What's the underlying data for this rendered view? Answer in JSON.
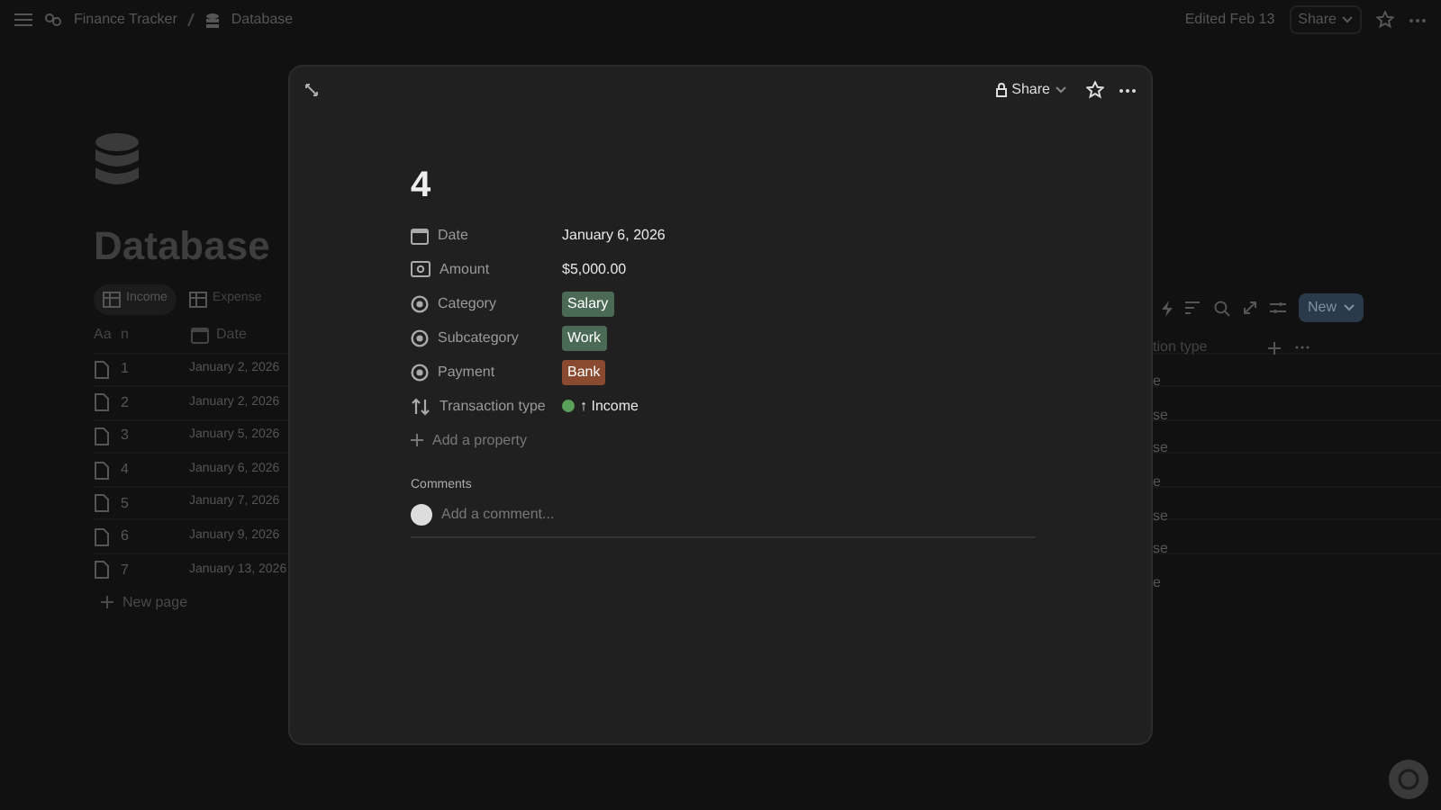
{
  "topbar": {
    "breadcrumbs": [
      "Finance Tracker",
      "Database"
    ],
    "edited": "Edited Feb 13",
    "share": "Share"
  },
  "page": {
    "title": "Database",
    "views": [
      {
        "label": "Income",
        "selected": true
      },
      {
        "label": "Expense",
        "selected": false
      }
    ],
    "new_button": "New",
    "columns": [
      "Aa",
      "n",
      "Date",
      "tion type"
    ],
    "rows": [
      {
        "name": "1",
        "date": "January 2, 2026",
        "type": "e"
      },
      {
        "name": "2",
        "date": "January 2, 2026",
        "type": "se"
      },
      {
        "name": "3",
        "date": "January 5, 2026",
        "type": "se"
      },
      {
        "name": "4",
        "date": "January 6, 2026",
        "type": "e"
      },
      {
        "name": "5",
        "date": "January 7, 2026",
        "type": "se"
      },
      {
        "name": "6",
        "date": "January 9, 2026",
        "type": "se"
      },
      {
        "name": "7",
        "date": "January 13, 2026",
        "type": "e"
      }
    ],
    "new_page": "New page"
  },
  "modal": {
    "share": "Share",
    "title": "4",
    "properties": [
      {
        "kind": "date",
        "label": "Date",
        "value": "January 6, 2026"
      },
      {
        "kind": "number",
        "label": "Amount",
        "value": "$5,000.00"
      },
      {
        "kind": "select",
        "label": "Category",
        "value": "Salary",
        "color": "#4b6a55"
      },
      {
        "kind": "select",
        "label": "Subcategory",
        "value": "Work",
        "color": "#4b6a55"
      },
      {
        "kind": "select",
        "label": "Payment",
        "value": "Bank",
        "color": "#8a4a30"
      },
      {
        "kind": "status",
        "label": "Transaction type",
        "value": "↑ Income",
        "color": "#5aa05a"
      }
    ],
    "add_property": "Add a property",
    "comments_label": "Comments",
    "comment_placeholder": "Add a comment..."
  }
}
